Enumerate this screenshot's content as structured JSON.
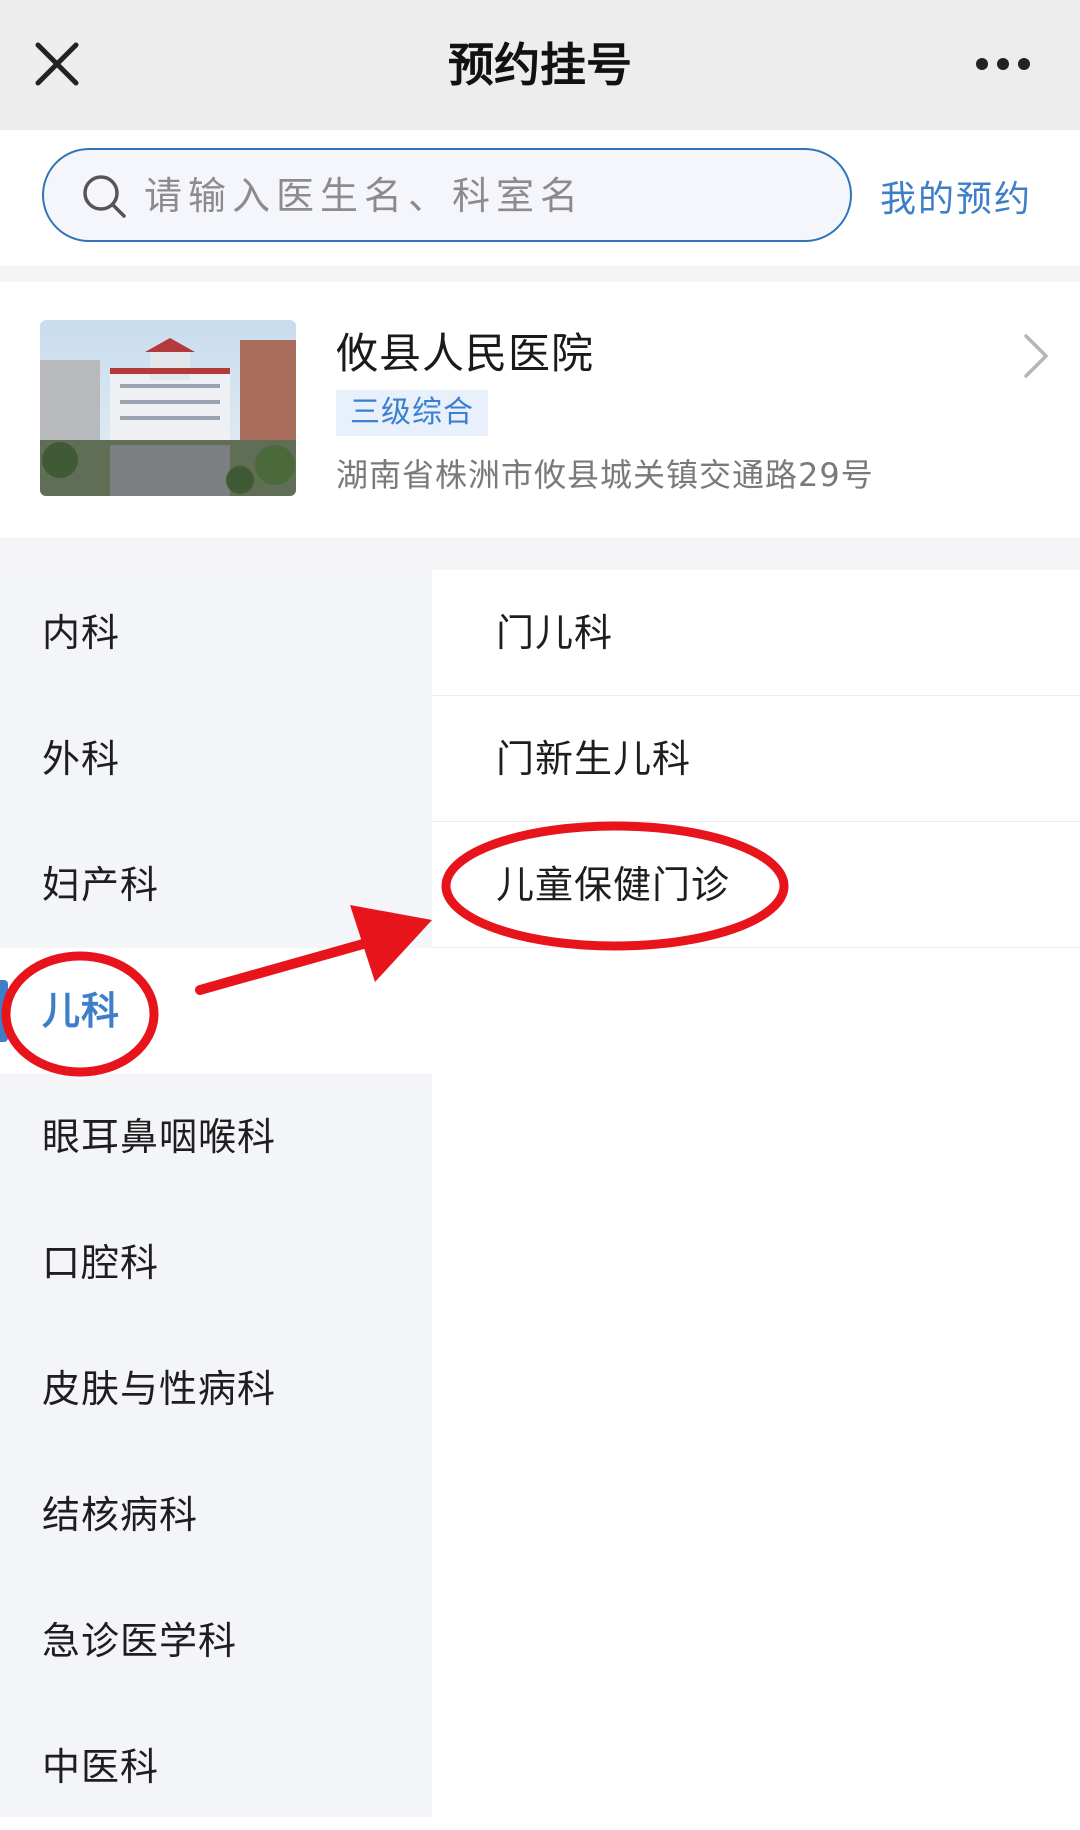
{
  "header": {
    "title": "预约挂号",
    "close_icon": "close-icon",
    "more_icon": "more-icon"
  },
  "search": {
    "placeholder": "请输入医生名、科室名",
    "value": "",
    "my_appointments": "我的预约"
  },
  "hospital": {
    "name": "攸县人民医院",
    "tag": "三级综合",
    "address": "湖南省株洲市攸县城关镇交通路29号"
  },
  "departments": [
    {
      "label": "内科",
      "active": false
    },
    {
      "label": "外科",
      "active": false
    },
    {
      "label": "妇产科",
      "active": false
    },
    {
      "label": "儿科",
      "active": true
    },
    {
      "label": "眼耳鼻咽喉科",
      "active": false
    },
    {
      "label": "口腔科",
      "active": false
    },
    {
      "label": "皮肤与性病科",
      "active": false
    },
    {
      "label": "结核病科",
      "active": false
    },
    {
      "label": "急诊医学科",
      "active": false
    },
    {
      "label": "中医科",
      "active": false
    }
  ],
  "subdepartments": [
    {
      "label": "门儿科"
    },
    {
      "label": "门新生儿科"
    },
    {
      "label": "儿童保健门诊"
    }
  ],
  "colors": {
    "accent": "#3d7ec8",
    "annotation": "#e8141c",
    "header_bg": "#ededed",
    "sidebar_bg": "#f4f5f9"
  }
}
